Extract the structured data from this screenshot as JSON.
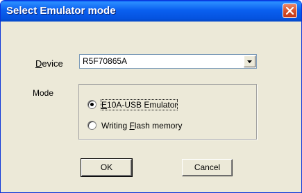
{
  "window": {
    "title": "Select Emulator mode",
    "close_icon": "close-icon"
  },
  "device": {
    "label_mnemonic": "D",
    "label_rest": "evice",
    "selected": "R5F70865A"
  },
  "mode": {
    "label": "Mode",
    "options": [
      {
        "mnemonic": "E",
        "rest": "10A-USB Emulator",
        "checked": true
      },
      {
        "prefix": "Writing ",
        "mnemonic": "F",
        "rest": "lash memory",
        "checked": false
      }
    ]
  },
  "buttons": {
    "ok": "OK",
    "cancel": "Cancel"
  }
}
